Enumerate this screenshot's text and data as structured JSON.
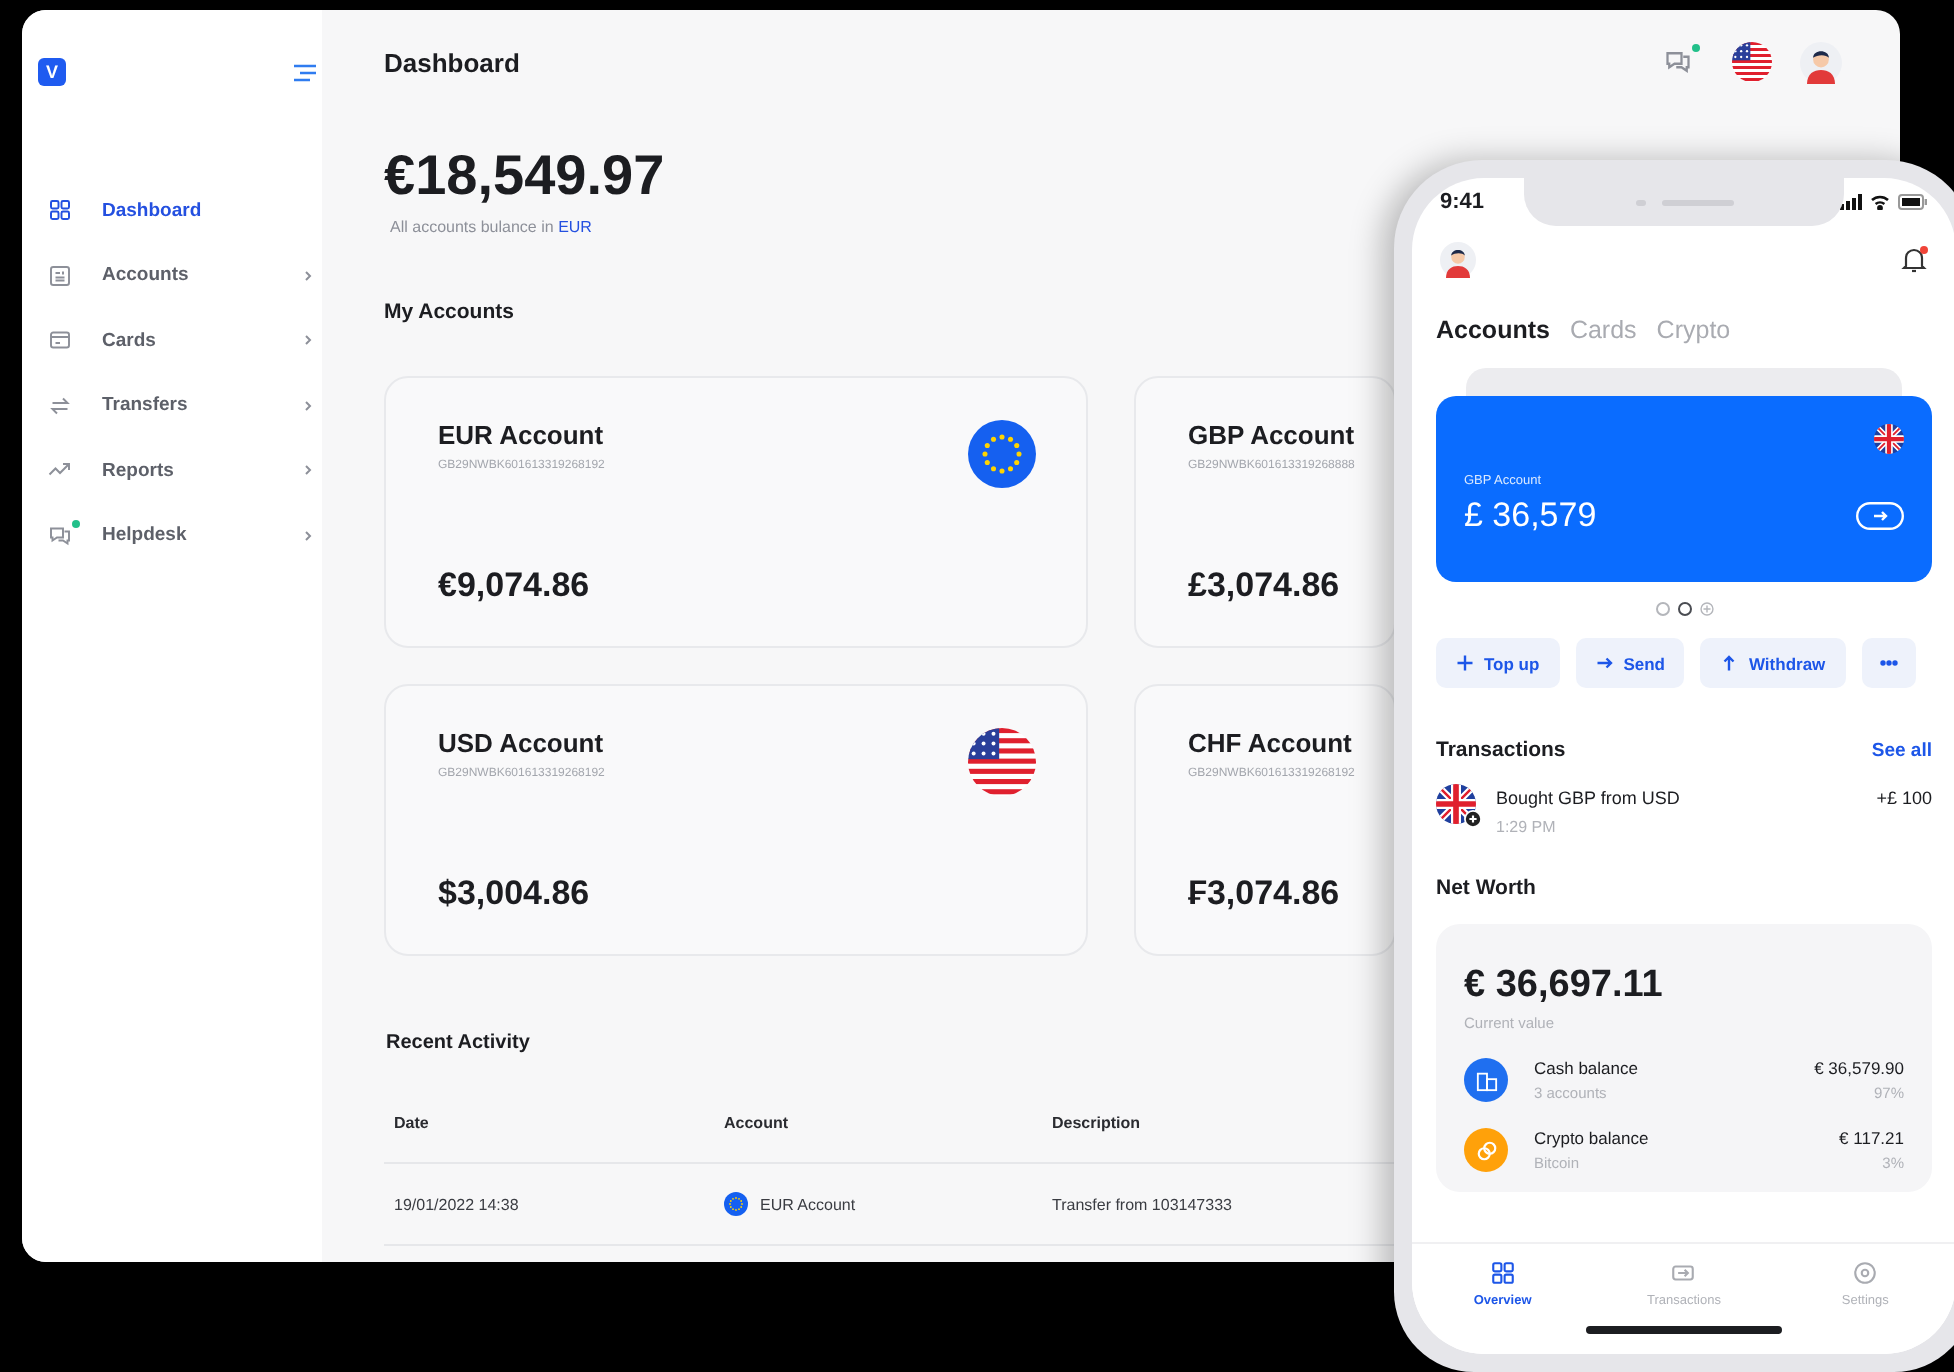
{
  "sidebar": {
    "logo": "V",
    "items": [
      {
        "label": "Dashboard",
        "selected": true,
        "submenu": false,
        "notification": false
      },
      {
        "label": "Accounts",
        "selected": false,
        "submenu": true,
        "notification": false
      },
      {
        "label": "Cards",
        "selected": false,
        "submenu": true,
        "notification": false
      },
      {
        "label": "Transfers",
        "selected": false,
        "submenu": true,
        "notification": false
      },
      {
        "label": "Reports",
        "selected": false,
        "submenu": true,
        "notification": false
      },
      {
        "label": "Helpdesk",
        "selected": false,
        "submenu": true,
        "notification": true
      }
    ]
  },
  "header": {
    "title": "Dashboard",
    "chat_notification": true
  },
  "balance": {
    "amount": "€18,549.97",
    "caption": "All accounts bulance in",
    "currency": "EUR"
  },
  "accounts_title": "My Accounts",
  "accounts": [
    {
      "name": "EUR Account",
      "iban": "GB29NWBK601613319268192",
      "amount": "€9,074.86",
      "kind": "eu"
    },
    {
      "name": "GBP Account",
      "iban": "GB29NWBK601613319268888",
      "amount": "£3,074.86"
    },
    {
      "name": "USD Account",
      "iban": "GB29NWBK601613319268192",
      "amount": "$3,004.86",
      "kind": "us"
    },
    {
      "name": "CHF Account",
      "iban": "GB29NWBK601613319268192",
      "amount": "₣3,074.86"
    }
  ],
  "recent_activity": {
    "title": "Recent Activity",
    "columns": [
      "Date",
      "Account",
      "Description"
    ],
    "rows": [
      {
        "date": "19/01/2022 14:38",
        "account": "EUR Account",
        "kind": "eu",
        "description": "Transfer from 103147333"
      }
    ]
  },
  "phone": {
    "time": "9:41",
    "bell_notification": true,
    "tabs": [
      {
        "label": "Accounts",
        "selected": true
      },
      {
        "label": "Cards",
        "selected": false
      },
      {
        "label": "Crypto",
        "selected": false
      }
    ],
    "card": {
      "label": "GBP Account",
      "amount": "£ 36,579",
      "kind": "gb"
    },
    "pager": [
      {
        "kind": "dot",
        "selected": false
      },
      {
        "kind": "dot",
        "selected": true
      },
      {
        "kind": "add",
        "selected": false
      }
    ],
    "actions": [
      {
        "kind": "plus",
        "label": "Top up"
      },
      {
        "kind": "arrow-right",
        "label": "Send"
      },
      {
        "kind": "arrow-up",
        "label": "Withdraw"
      },
      {
        "kind": "more"
      }
    ],
    "transactions_title": "Transactions",
    "see_all": "See all",
    "transactions": [
      {
        "title": "Bought GBP from USD",
        "time": "1:29 PM",
        "amount": "+£ 100",
        "kind": "gb"
      }
    ],
    "net_worth_title": "Net Worth",
    "net_worth": {
      "amount": "€ 36,697.11",
      "caption": "Current value",
      "items": [
        {
          "kind": "cash",
          "title": "Cash balance",
          "subtitle": "3 accounts",
          "amount": "€ 36,579.90",
          "share": "97%"
        },
        {
          "kind": "crypto",
          "title": "Crypto balance",
          "subtitle": "Bitcoin",
          "amount": "€ 117.21",
          "share": "3%"
        }
      ]
    },
    "nav": [
      {
        "label": "Overview",
        "selected": true
      },
      {
        "label": "Transactions",
        "selected": false
      },
      {
        "label": "Settings",
        "selected": false
      }
    ]
  }
}
